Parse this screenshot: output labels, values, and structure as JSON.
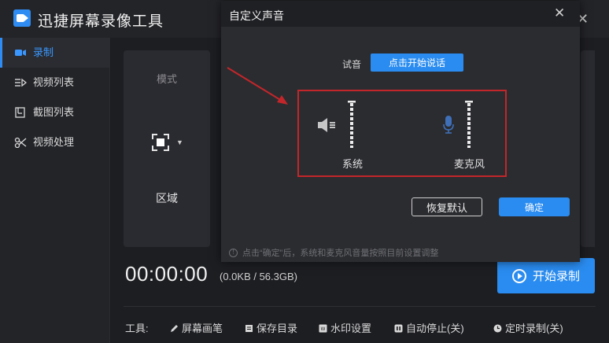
{
  "app": {
    "title": "迅捷屏幕录像工具",
    "close_glyph": "✕"
  },
  "sidebar": {
    "items": [
      {
        "label": "录制",
        "icon": "video-camera-icon",
        "active": true
      },
      {
        "label": "视频列表",
        "icon": "video-list-icon",
        "active": false
      },
      {
        "label": "截图列表",
        "icon": "screenshot-list-icon",
        "active": false
      },
      {
        "label": "视频处理",
        "icon": "video-process-icon",
        "active": false
      }
    ]
  },
  "mode": {
    "label": "模式",
    "region_label": "区域",
    "caret": "▼"
  },
  "recording": {
    "timer": "00:00:00",
    "storage": "(0.0KB / 56.3GB)",
    "start_label": "开始录制"
  },
  "toolbar": {
    "label": "工具:",
    "items": [
      {
        "label": "屏幕画笔",
        "icon": "pen-icon"
      },
      {
        "label": "保存目录",
        "icon": "folder-icon"
      },
      {
        "label": "水印设置",
        "icon": "watermark-icon"
      },
      {
        "label": "自动停止(关)",
        "icon": "auto-stop-icon"
      },
      {
        "label": "定时录制(关)",
        "icon": "clock-icon"
      }
    ]
  },
  "dialog": {
    "title": "自定义声音",
    "close_glyph": "✕",
    "try_label": "试音",
    "speak_button": "点击开始说话",
    "system_label": "系统",
    "mic_label": "麦克风",
    "reset_button": "恢复默认",
    "confirm_button": "确定",
    "note": "点击“确定”后，系统和麦克风音量按照目前设置调整",
    "info_glyph": "!"
  },
  "colors": {
    "accent": "#2a8cf0",
    "highlight": "#c3262a",
    "background": "#1b1c1f",
    "panel": "#2a2b30"
  }
}
